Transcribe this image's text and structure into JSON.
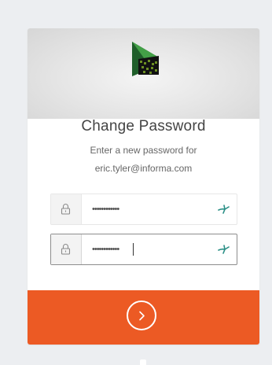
{
  "page": {
    "title": "Change Password"
  },
  "prompt": {
    "line1": "Enter a new password for",
    "line2": "eric.tyler@informa.com"
  },
  "fields": [
    {
      "icon": "lock-icon",
      "value": "••••••••••••",
      "reveal_icon": "show-password-icon"
    },
    {
      "icon": "lock-icon",
      "value": "••••••••••••",
      "reveal_icon": "show-password-icon",
      "focused": true
    }
  ],
  "submit": {
    "icon": "chevron-right-icon"
  },
  "colors": {
    "accent": "#ec5a24",
    "background": "#eceef1",
    "logo_green": "#2e7d32",
    "reveal_icon_color": "#2a8f86"
  }
}
